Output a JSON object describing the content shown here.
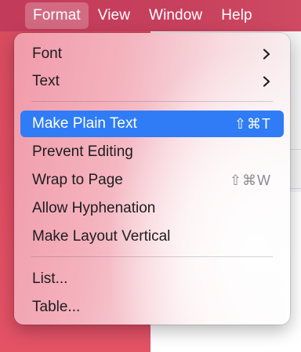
{
  "menubar": {
    "items": [
      {
        "label": "Format",
        "active": true
      },
      {
        "label": "View"
      },
      {
        "label": "Window"
      },
      {
        "label": "Help"
      }
    ]
  },
  "format_menu": {
    "items": [
      {
        "label": "Font",
        "submenu_icon": "chevron-right-icon"
      },
      {
        "label": "Text",
        "submenu_icon": "chevron-right-icon"
      },
      {
        "label": "Make Plain Text",
        "shortcut": "⇧⌘T",
        "highlighted": true
      },
      {
        "label": "Prevent Editing"
      },
      {
        "label": "Wrap to Page",
        "shortcut": "⇧⌘W",
        "shortcut_disabled": true
      },
      {
        "label": "Allow Hyphenation"
      },
      {
        "label": "Make Layout Vertical"
      },
      {
        "label": "List..."
      },
      {
        "label": "Table..."
      }
    ]
  },
  "colors": {
    "highlight": "#2f7cf6",
    "menubar": "#c7405d",
    "desktop": "#e04d63"
  }
}
